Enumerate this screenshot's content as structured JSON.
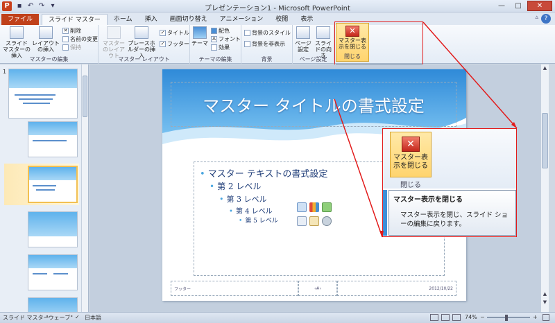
{
  "titlebar": {
    "app_icon": "P",
    "title": "プレゼンテーション1 - Microsoft PowerPoint",
    "qat_icons": [
      "save-icon",
      "undo-icon",
      "redo-icon",
      "customize-icon"
    ],
    "qat_glyphs": [
      "▪",
      "↶",
      "↷",
      "▾"
    ],
    "buttons": {
      "minimize": "—",
      "maximize": "□",
      "close": "✕"
    }
  },
  "tabs": [
    {
      "label": "ファイル"
    },
    {
      "label": "スライド マスター"
    },
    {
      "label": "ホーム"
    },
    {
      "label": "挿入"
    },
    {
      "label": "画面切り替え"
    },
    {
      "label": "アニメーション"
    },
    {
      "label": "校閲"
    },
    {
      "label": "表示"
    }
  ],
  "tabs_right": {
    "minimize": "▵",
    "help": "?"
  },
  "ribbon": {
    "master_edit": {
      "label": "マスターの編集",
      "insert_slide_master": "スライド マスターの挿入",
      "insert_layout": "レイアウトの挿入",
      "delete": "削除",
      "rename": "名前の変更",
      "preserve": "保持"
    },
    "master_layout": {
      "label": "マスター レイアウト",
      "master_layout_btn": "マスターのレイアウト",
      "insert_placeholder": "プレースホルダーの挿入",
      "title_check": "タイトル",
      "footer_check": "フッター"
    },
    "edit_theme": {
      "label": "テーマの編集",
      "theme": "テーマ",
      "colors": "配色",
      "fonts": "フォント",
      "effects": "効果"
    },
    "background": {
      "label": "背景",
      "bg_styles": "背景のスタイル",
      "hide_bg": "背景を非表示"
    },
    "page_setup": {
      "label": "ページ設定",
      "page_setup_btn": "ページ設定",
      "orientation": "スライドの向き"
    },
    "close": {
      "label": "閉じる",
      "close_master": "マスター表示を閉じる"
    }
  },
  "tooltip": {
    "title": "マスター表示を閉じる",
    "description": "マスター表示を閉じ、スライド ショーの編集に戻ります。"
  },
  "thumbnails": {
    "first_number": "1",
    "first_title": "マスター タイトルの書式設定",
    "layout_title": "マスター タイトルの書式設定"
  },
  "slide": {
    "title": "マスター タイトルの書式設定",
    "levels": [
      "マスター テキストの書式設定",
      "第 2 レベル",
      "第 3 レベル",
      "第 4 レベル",
      "第 5 レベル"
    ],
    "bullet": "•",
    "footer": "フッター",
    "page_num": "‹#›",
    "date": "2012/10/22"
  },
  "status": {
    "view": "スライド マスター",
    "theme": "\"ウェーブ\"",
    "language": "日本語",
    "zoom": "74%",
    "zoom_out": "−",
    "zoom_in": "+"
  },
  "colors": {
    "accent_red": "#e21b1b",
    "file_tab": "#c0401a",
    "highlight": "#ffd46e",
    "title_blue": "#1f3d78"
  }
}
